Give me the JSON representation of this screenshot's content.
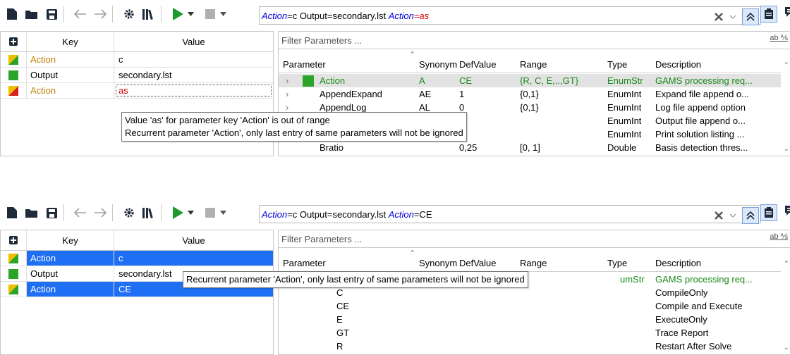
{
  "panel1": {
    "command": {
      "k1": "Action",
      "v1": "=c Output=secondary.lst ",
      "k2": "Action",
      "v2": "=as"
    },
    "header": {
      "key": "Key",
      "value": "Value"
    },
    "rows": [
      {
        "key": "Action",
        "value": "c",
        "flag": "yellow"
      },
      {
        "key": "Output",
        "value": "secondary.lst",
        "flag": "green"
      },
      {
        "key": "Action",
        "value": "as",
        "flag": "red"
      }
    ],
    "filter_placeholder": "Filter Parameters ...",
    "param_headers": {
      "parameter": "Parameter",
      "synonym": "Synonym",
      "defvalue": "DefValue",
      "range": "Range",
      "type": "Type",
      "description": "Description"
    },
    "params": [
      {
        "parameter": "Action",
        "synonym": "A",
        "defvalue": "CE",
        "range": "{R, C, E,..,GT}",
        "type": "EnumStr",
        "description": "GAMS processing req..."
      },
      {
        "parameter": "AppendExpand",
        "synonym": "AE",
        "defvalue": "1",
        "range": "{0,1}",
        "type": "EnumInt",
        "description": "Expand file append o..."
      },
      {
        "parameter": "AppendLog",
        "synonym": "AL",
        "defvalue": "0",
        "range": "{0,1}",
        "type": "EnumInt",
        "description": "Log file append option"
      },
      {
        "parameter": "",
        "synonym": "",
        "defvalue": "",
        "range": "",
        "type": "EnumInt",
        "description": "Output file append o..."
      },
      {
        "parameter": "",
        "synonym": "",
        "defvalue": "",
        "range": "",
        "type": "EnumInt",
        "description": "Print solution listing ..."
      },
      {
        "parameter": "Bratio",
        "synonym": "",
        "defvalue": "0,25",
        "range": "[0, 1]",
        "type": "Double",
        "description": "Basis detection thres..."
      }
    ],
    "tooltip": [
      "Value 'as' for parameter key 'Action' is out of range",
      "Recurrent parameter 'Action', only last entry of same parameters will not be ignored"
    ]
  },
  "panel2": {
    "command": {
      "k1": "Action",
      "v1": "=c Output=secondary.lst ",
      "k2": "Action",
      "v2": "=CE"
    },
    "header": {
      "key": "Key",
      "value": "Value"
    },
    "rows": [
      {
        "key": "Action",
        "value": "c",
        "flag": "yellow"
      },
      {
        "key": "Output",
        "value": "secondary.lst",
        "flag": "green"
      },
      {
        "key": "Action",
        "value": "CE",
        "flag": "yellow"
      }
    ],
    "filter_placeholder": "Filter Parameters ...",
    "param_headers": {
      "parameter": "Parameter",
      "synonym": "Synonym",
      "defvalue": "DefValue",
      "range": "Range",
      "type": "Type",
      "description": "Description"
    },
    "partial_type": "umStr",
    "sub_params": [
      {
        "value": "",
        "description": "GAMS processing req..."
      },
      {
        "value": "C",
        "description": "CompileOnly"
      },
      {
        "value": "CE",
        "description": "Compile and Execute"
      },
      {
        "value": "E",
        "description": "ExecuteOnly"
      },
      {
        "value": "GT",
        "description": "Trace Report"
      },
      {
        "value": "R",
        "description": "Restart After Solve"
      }
    ],
    "tooltip": [
      "Recurrent parameter 'Action', only last entry of same parameters will not be ignored"
    ]
  }
}
